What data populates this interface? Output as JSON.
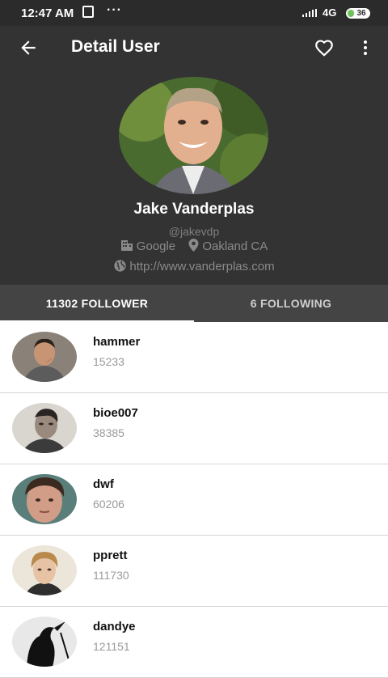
{
  "status_bar": {
    "time": "12:47 AM",
    "dots": "···",
    "network": "4G",
    "battery": "36"
  },
  "app_bar": {
    "title": "Detail User",
    "back_icon": "arrow-left-icon",
    "favorite_icon": "heart-outline-icon",
    "menu_icon": "more-vertical-icon"
  },
  "profile": {
    "name": "Jake Vanderplas",
    "username": "@jakevdp",
    "company": "Google",
    "location": "Oakland CA",
    "blog": "http://www.vanderplas.com"
  },
  "tabs": [
    {
      "label": "11302 FOLLOWER",
      "active": true
    },
    {
      "label": "6 FOLLOWING",
      "active": false
    }
  ],
  "followers": [
    {
      "login": "hammer",
      "id": "15233"
    },
    {
      "login": "bioe007",
      "id": "38385"
    },
    {
      "login": "dwf",
      "id": "60206"
    },
    {
      "login": "pprett",
      "id": "111730"
    },
    {
      "login": "dandye",
      "id": "121151"
    }
  ],
  "colors": {
    "app_bar": "#333333",
    "status_bar": "#2b2b2b",
    "tab_bar": "#444444",
    "secondary_text": "#9a9a9a"
  }
}
